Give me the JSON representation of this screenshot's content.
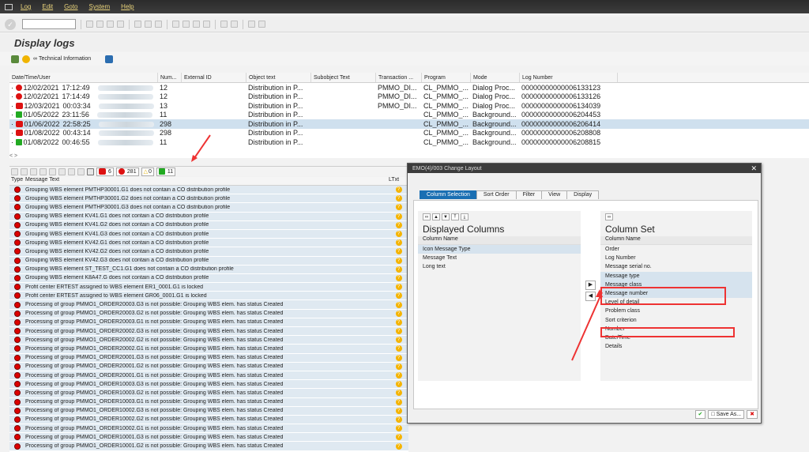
{
  "menubar": {
    "items": [
      "Log",
      "Edit",
      "Goto",
      "System",
      "Help"
    ]
  },
  "title": "Display logs",
  "app_toolbar": {
    "tech_info_label": "Technical Information"
  },
  "log_table": {
    "headers": [
      "Date/Time/User",
      "Num...",
      "External ID",
      "Object text",
      "Subobject Text",
      "Transaction ...",
      "Program",
      "Mode",
      "Log Number"
    ],
    "rows": [
      {
        "status": "red",
        "date": "12/02/2021",
        "time": "17:12:49",
        "num": "12",
        "object": "Distribution in P...",
        "transaction": "PMMO_DI...",
        "program": "CL_PMMO_...",
        "mode": "Dialog Proc...",
        "log": "00000000000006133123"
      },
      {
        "status": "red",
        "date": "12/02/2021",
        "time": "17:14:49",
        "num": "12",
        "object": "Distribution in P...",
        "transaction": "PMMO_DI...",
        "program": "CL_PMMO_...",
        "mode": "Dialog Proc...",
        "log": "00000000000006133126"
      },
      {
        "status": "stop",
        "date": "12/03/2021",
        "time": "00:03:34",
        "num": "13",
        "object": "Distribution in P...",
        "transaction": "PMMO_DI...",
        "program": "CL_PMMO_...",
        "mode": "Dialog Proc...",
        "log": "00000000000006134039"
      },
      {
        "status": "green",
        "date": "01/05/2022",
        "time": "23:11:56",
        "num": "11",
        "object": "Distribution in P...",
        "transaction": "",
        "program": "CL_PMMO_...",
        "mode": "Background...",
        "log": "00000000000006204453"
      },
      {
        "status": "stop",
        "date": "01/06/2022",
        "time": "22:58:25",
        "num": "298",
        "object": "Distribution in P...",
        "transaction": "",
        "program": "CL_PMMO_...",
        "mode": "Background...",
        "log": "00000000000006206414",
        "selected": true
      },
      {
        "status": "stop",
        "date": "01/08/2022",
        "time": "00:43:14",
        "num": "298",
        "object": "Distribution in P...",
        "transaction": "",
        "program": "CL_PMMO_...",
        "mode": "Background...",
        "log": "00000000000006208808"
      },
      {
        "status": "green",
        "date": "01/08/2022",
        "time": "00:46:55",
        "num": "11",
        "object": "Distribution in P...",
        "transaction": "",
        "program": "CL_PMMO_...",
        "mode": "Background...",
        "log": "00000000000006208815"
      }
    ]
  },
  "message_toolbar": {
    "counts": {
      "stop": "6",
      "error": "281",
      "warning": "0",
      "success": "11"
    }
  },
  "message_table": {
    "headers": [
      "Type",
      "Message Text",
      "LTxt"
    ],
    "rows": [
      "Grouping WBS element PMTHP30001.G1 does not contain a CO distribution profile",
      "Grouping WBS element PMTHP30001.G2 does not contain a CO distribution profile",
      "Grouping WBS element PMTHP30001.G3 does not contain a CO distribution profile",
      "Grouping WBS element KV41.G1 does not contain a CO distribution profile",
      "Grouping WBS element KV41.G2 does not contain a CO distribution profile",
      "Grouping WBS element KV41.G3 does not contain a CO distribution profile",
      "Grouping WBS element KV42.G1 does not contain a CO distribution profile",
      "Grouping WBS element KV42.G2 does not contain a CO distribution profile",
      "Grouping WBS element KV42.G3 does not contain a CO distribution profile",
      "Grouping WBS element ST_TEST_CC1.G1 does not contain a CO distribution profile",
      "Grouping WBS element K8A47.G does not contain a CO distribution profile",
      "Profit center ERTEST assigned to WBS element ER1_0001.G1 is locked",
      "Profit center ERTEST assigned to WBS element GR06_0001.G1 is locked",
      "Processing of group PMMO1_ORDER20003.G3 is not possible: Grouping WBS elem. has status Created",
      "Processing of group PMMO1_ORDER20003.G2 is not possible: Grouping WBS elem. has status Created",
      "Processing of group PMMO1_ORDER20003.G1 is not possible: Grouping WBS elem. has status Created",
      "Processing of group PMMO1_ORDER20002.G3 is not possible: Grouping WBS elem. has status Created",
      "Processing of group PMMO1_ORDER20002.G2 is not possible: Grouping WBS elem. has status Created",
      "Processing of group PMMO1_ORDER20002.G1 is not possible: Grouping WBS elem. has status Created",
      "Processing of group PMMO1_ORDER20001.G3 is not possible: Grouping WBS elem. has status Created",
      "Processing of group PMMO1_ORDER20001.G2 is not possible: Grouping WBS elem. has status Created",
      "Processing of group PMMO1_ORDER20001.G1 is not possible: Grouping WBS elem. has status Created",
      "Processing of group PMMO1_ORDER10003.G3 is not possible: Grouping WBS elem. has status Created",
      "Processing of group PMMO1_ORDER10003.G2 is not possible: Grouping WBS elem. has status Created",
      "Processing of group PMMO1_ORDER10003.G1 is not possible: Grouping WBS elem. has status Created",
      "Processing of group PMMO1_ORDER10002.G3 is not possible: Grouping WBS elem. has status Created",
      "Processing of group PMMO1_ORDER10002.G2 is not possible: Grouping WBS elem. has status Created",
      "Processing of group PMMO1_ORDER10002.G1 is not possible: Grouping WBS elem. has status Created",
      "Processing of group PMMO1_ORDER10001.G3 is not possible: Grouping WBS elem. has status Created",
      "Processing of group PMMO1_ORDER10001.G2 is not possible: Grouping WBS elem. has status Created"
    ]
  },
  "dialog": {
    "title": "EMO(4)/003 Change Layout",
    "tabs": [
      "Column Selection",
      "Sort Order",
      "Filter",
      "View",
      "Display"
    ],
    "displayed": {
      "title": "Displayed Columns",
      "col_header": "Column Name",
      "items": [
        "Icon Message Type",
        "Message Text",
        "Long text"
      ]
    },
    "colset": {
      "title": "Column Set",
      "col_header": "Column Name",
      "items": [
        "Order",
        "Log Number",
        "Message serial no.",
        "Message type",
        "Message class",
        "Message number",
        "Level of detail",
        "Problem class",
        "Sort criterion",
        "Number",
        "Date/Time",
        "Details"
      ]
    },
    "save_as": "Save As..."
  }
}
